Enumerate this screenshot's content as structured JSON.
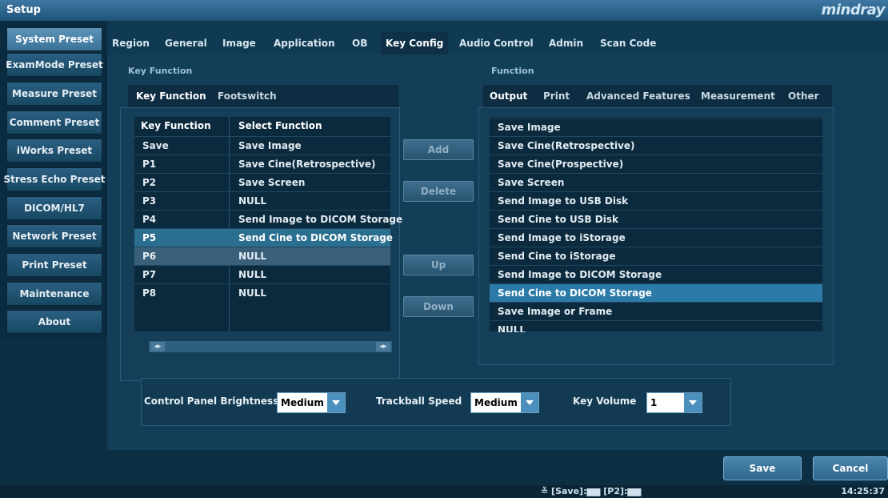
{
  "window": {
    "title": "Setup",
    "brand": "mindray"
  },
  "sidebar": {
    "items": [
      {
        "label": "System Preset",
        "active": true
      },
      {
        "label": "ExamMode Preset"
      },
      {
        "label": "Measure Preset"
      },
      {
        "label": "Comment Preset"
      },
      {
        "label": "iWorks Preset"
      },
      {
        "label": "Stress Echo Preset"
      },
      {
        "label": "DICOM/HL7"
      },
      {
        "label": "Network Preset"
      },
      {
        "label": "Print Preset"
      },
      {
        "label": "Maintenance"
      },
      {
        "label": "About"
      }
    ]
  },
  "tabs": [
    "Region",
    "General",
    "Image",
    "Application",
    "OB",
    "Key Config",
    "Audio Control",
    "Admin",
    "Scan Code"
  ],
  "active_tab": "Key Config",
  "left_panel": {
    "section_label": "Key Function",
    "subtabs": [
      "Key Function",
      "Footswitch"
    ],
    "columns": [
      "Key Function",
      "Select Function"
    ],
    "rows": [
      {
        "key": "Save",
        "func": "Save Image"
      },
      {
        "key": "P1",
        "func": "Save Cine(Retrospective)"
      },
      {
        "key": "P2",
        "func": "Save Screen"
      },
      {
        "key": "P3",
        "func": "NULL"
      },
      {
        "key": "P4",
        "func": "Send Image to DICOM Storage"
      },
      {
        "key": "P5",
        "func": "Send Cine to DICOM Storage"
      },
      {
        "key": "P6",
        "func": "NULL"
      },
      {
        "key": "P7",
        "func": "NULL"
      },
      {
        "key": "P8",
        "func": "NULL"
      }
    ]
  },
  "mid_buttons": {
    "add": "Add",
    "delete": "Delete",
    "up": "Up",
    "down": "Down"
  },
  "right_panel": {
    "section_label": "Function",
    "subtabs": [
      "Output",
      "Print",
      "Advanced Features",
      "Measurement",
      "Other"
    ],
    "items": [
      "Save Image",
      "Save Cine(Retrospective)",
      "Save Cine(Prospective)",
      "Save Screen",
      "Send Image to USB Disk",
      "Send Cine to USB Disk",
      "Send Image to iStorage",
      "Send Cine to iStorage",
      "Send Image to DICOM Storage",
      "Send Cine to DICOM Storage",
      "Save Image or Frame",
      "NULL"
    ],
    "selected_index": 9
  },
  "settings": {
    "brightness_label": "Control Panel Brightness",
    "brightness_value": "Medium",
    "trackball_label": "Trackball Speed",
    "trackball_value": "Medium",
    "volume_label": "Key Volume",
    "volume_value": "1"
  },
  "footer": {
    "save": "Save",
    "cancel": "Cancel"
  },
  "status": {
    "text": "≚ [Save]:▆▆ [P2]:▆▆",
    "clock": "14:25:37"
  }
}
